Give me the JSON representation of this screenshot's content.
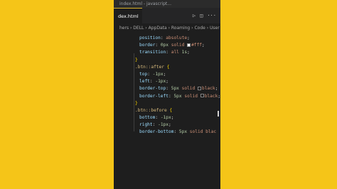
{
  "window": {
    "title": "index.html - javascript..."
  },
  "tabs": [
    {
      "label": "dex.html"
    }
  ],
  "toolbar": {
    "run_icon": "play-icon",
    "split_icon": "split-editor-icon",
    "more_icon": "more-icon",
    "run_glyph": "▷",
    "split_glyph": "◫",
    "more_glyph": "···"
  },
  "breadcrumb": "hers › DELL › AppData › Roaming › Code › User › ",
  "colors": {
    "accent": "#f5c518",
    "editor_bg": "#1e1e1e",
    "property": "#9cdcfe",
    "value": "#ce9178",
    "number": "#b5cea8",
    "selector": "#d7ba7d",
    "brace": "#ffd700"
  },
  "code": {
    "l1": {
      "prop": "position",
      "colon": ": ",
      "val": "absolute",
      "semi": ";"
    },
    "l2": {
      "prop": "border",
      "colon": ": ",
      "num": "0px",
      "val": " solid ",
      "color": "#fff",
      "semi": ";"
    },
    "l3": {
      "prop": "transition",
      "colon": ": ",
      "val": "all ",
      "num": "1s",
      "semi": ";"
    },
    "l4": {
      "brace": "}"
    },
    "l5": {
      "sel": ".btn::after",
      "brace": " {"
    },
    "l6": {
      "prop": "top",
      "colon": ": ",
      "num": "-1px",
      "semi": ";"
    },
    "l7": {
      "prop": "left",
      "colon": ": ",
      "num": "-1px",
      "semi": ";"
    },
    "l8": {
      "prop": "border-top",
      "colon": ": ",
      "num": "5px",
      "val": " solid ",
      "color": "black",
      "semi": ";"
    },
    "l9": {
      "prop": "border-left",
      "colon": ": ",
      "num": "5px",
      "val": " solid ",
      "color": "black",
      "semi": ";"
    },
    "l10": {
      "brace": "}"
    },
    "l11": {
      "sel": ".btn::before",
      "brace": " {"
    },
    "l12": {
      "prop": "bottom",
      "colon": ": ",
      "num": "-1px",
      "semi": ";"
    },
    "l13": {
      "prop": "right",
      "colon": ": ",
      "num": "-1px",
      "semi": ";"
    },
    "l14": {
      "prop": "border-bottom",
      "colon": ": ",
      "num": "5px",
      "val": " solid ",
      "color": "blac"
    }
  }
}
